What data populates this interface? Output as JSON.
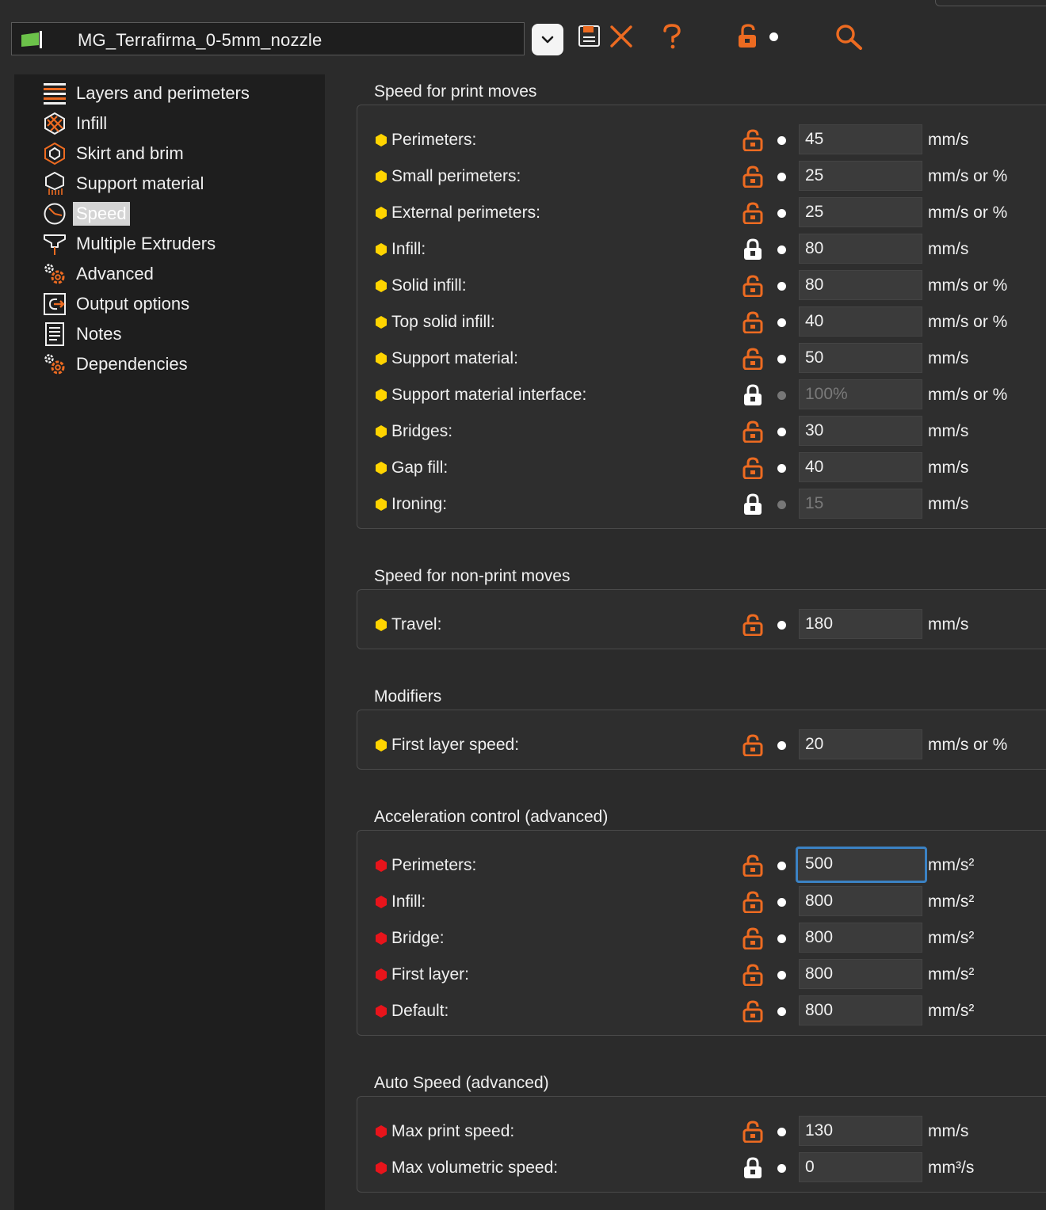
{
  "toolbar": {
    "preset_name": "MG_Terrafirma_0-5mm_nozzle",
    "icons": [
      "preset-flag-icon",
      "chevron-down-icon",
      "save-icon",
      "delete-icon",
      "help-icon",
      "lock-icon",
      "dot-icon",
      "search-icon"
    ]
  },
  "colors": {
    "accent_orange": "#ed6b21",
    "marker_yellow": "#ffd400",
    "marker_red": "#e8141b",
    "focus_blue": "#3b82c4",
    "sidebar_bg": "#1e1e1e",
    "panel_bg": "#2b2b2b"
  },
  "sidebar": {
    "items": [
      {
        "label": "Layers and perimeters",
        "icon": "layers-icon",
        "selected": false
      },
      {
        "label": "Infill",
        "icon": "infill-icon",
        "selected": false
      },
      {
        "label": "Skirt and brim",
        "icon": "skirt-brim-icon",
        "selected": false
      },
      {
        "label": "Support material",
        "icon": "support-icon",
        "selected": false
      },
      {
        "label": "Speed",
        "icon": "clock-icon",
        "selected": true
      },
      {
        "label": "Multiple Extruders",
        "icon": "extruder-icon",
        "selected": false
      },
      {
        "label": "Advanced",
        "icon": "gears-icon",
        "selected": false
      },
      {
        "label": "Output options",
        "icon": "output-icon",
        "selected": false
      },
      {
        "label": "Notes",
        "icon": "notes-icon",
        "selected": false
      },
      {
        "label": "Dependencies",
        "icon": "gears-icon",
        "selected": false
      }
    ]
  },
  "sections": [
    {
      "title": "Speed for print moves",
      "rows": [
        {
          "label": "Perimeters:",
          "value": "45",
          "unit": "mm/s",
          "lock": "unlocked",
          "marker": "yellow"
        },
        {
          "label": "Small perimeters:",
          "value": "25",
          "unit": "mm/s or %",
          "lock": "unlocked",
          "marker": "yellow"
        },
        {
          "label": "External perimeters:",
          "value": "25",
          "unit": "mm/s or %",
          "lock": "unlocked",
          "marker": "yellow"
        },
        {
          "label": "Infill:",
          "value": "80",
          "unit": "mm/s",
          "lock": "locked",
          "marker": "yellow"
        },
        {
          "label": "Solid infill:",
          "value": "80",
          "unit": "mm/s or %",
          "lock": "unlocked",
          "marker": "yellow"
        },
        {
          "label": "Top solid infill:",
          "value": "40",
          "unit": "mm/s or %",
          "lock": "unlocked",
          "marker": "yellow"
        },
        {
          "label": "Support material:",
          "value": "50",
          "unit": "mm/s",
          "lock": "unlocked",
          "marker": "yellow"
        },
        {
          "label": "Support material interface:",
          "value": "100%",
          "unit": "mm/s or %",
          "lock": "locked",
          "marker": "yellow",
          "disabled": true
        },
        {
          "label": "Bridges:",
          "value": "30",
          "unit": "mm/s",
          "lock": "unlocked",
          "marker": "yellow"
        },
        {
          "label": "Gap fill:",
          "value": "40",
          "unit": "mm/s",
          "lock": "unlocked",
          "marker": "yellow"
        },
        {
          "label": "Ironing:",
          "value": "15",
          "unit": "mm/s",
          "lock": "locked",
          "marker": "yellow",
          "disabled": true
        }
      ]
    },
    {
      "title": "Speed for non-print moves",
      "rows": [
        {
          "label": "Travel:",
          "value": "180",
          "unit": "mm/s",
          "lock": "unlocked",
          "marker": "yellow"
        }
      ]
    },
    {
      "title": "Modifiers",
      "rows": [
        {
          "label": "First layer speed:",
          "value": "20",
          "unit": "mm/s or %",
          "lock": "unlocked",
          "marker": "yellow"
        }
      ]
    },
    {
      "title": "Acceleration control (advanced)",
      "rows": [
        {
          "label": "Perimeters:",
          "value": "500",
          "unit": "mm/s²",
          "lock": "unlocked",
          "marker": "red",
          "focused": true
        },
        {
          "label": "Infill:",
          "value": "800",
          "unit": "mm/s²",
          "lock": "unlocked",
          "marker": "red"
        },
        {
          "label": "Bridge:",
          "value": "800",
          "unit": "mm/s²",
          "lock": "unlocked",
          "marker": "red"
        },
        {
          "label": "First layer:",
          "value": "800",
          "unit": "mm/s²",
          "lock": "unlocked",
          "marker": "red"
        },
        {
          "label": "Default:",
          "value": "800",
          "unit": "mm/s²",
          "lock": "unlocked",
          "marker": "red"
        }
      ]
    },
    {
      "title": "Auto Speed (advanced)",
      "rows": [
        {
          "label": "Max print speed:",
          "value": "130",
          "unit": "mm/s",
          "lock": "unlocked",
          "marker": "red"
        },
        {
          "label": "Max volumetric speed:",
          "value": "0",
          "unit": "mm³/s",
          "lock": "locked",
          "marker": "red"
        }
      ]
    }
  ]
}
